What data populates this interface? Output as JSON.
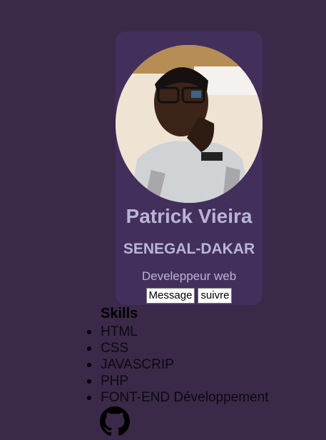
{
  "profile": {
    "name": "Patrick Vieira",
    "location": "SENEGAL-DAKAR",
    "role": "Develeppeur web",
    "buttons": {
      "message": "Message",
      "follow": "suivre"
    }
  },
  "skills": {
    "title": "Skills",
    "items": [
      "HTML",
      "CSS",
      "JAVASCRIP",
      "PHP",
      "FONT-END Développement"
    ]
  },
  "icons": {
    "social": "github-icon"
  },
  "colors": {
    "background": "#3a2948",
    "card": "#432f5c",
    "card_text": "#b9b5d6"
  }
}
